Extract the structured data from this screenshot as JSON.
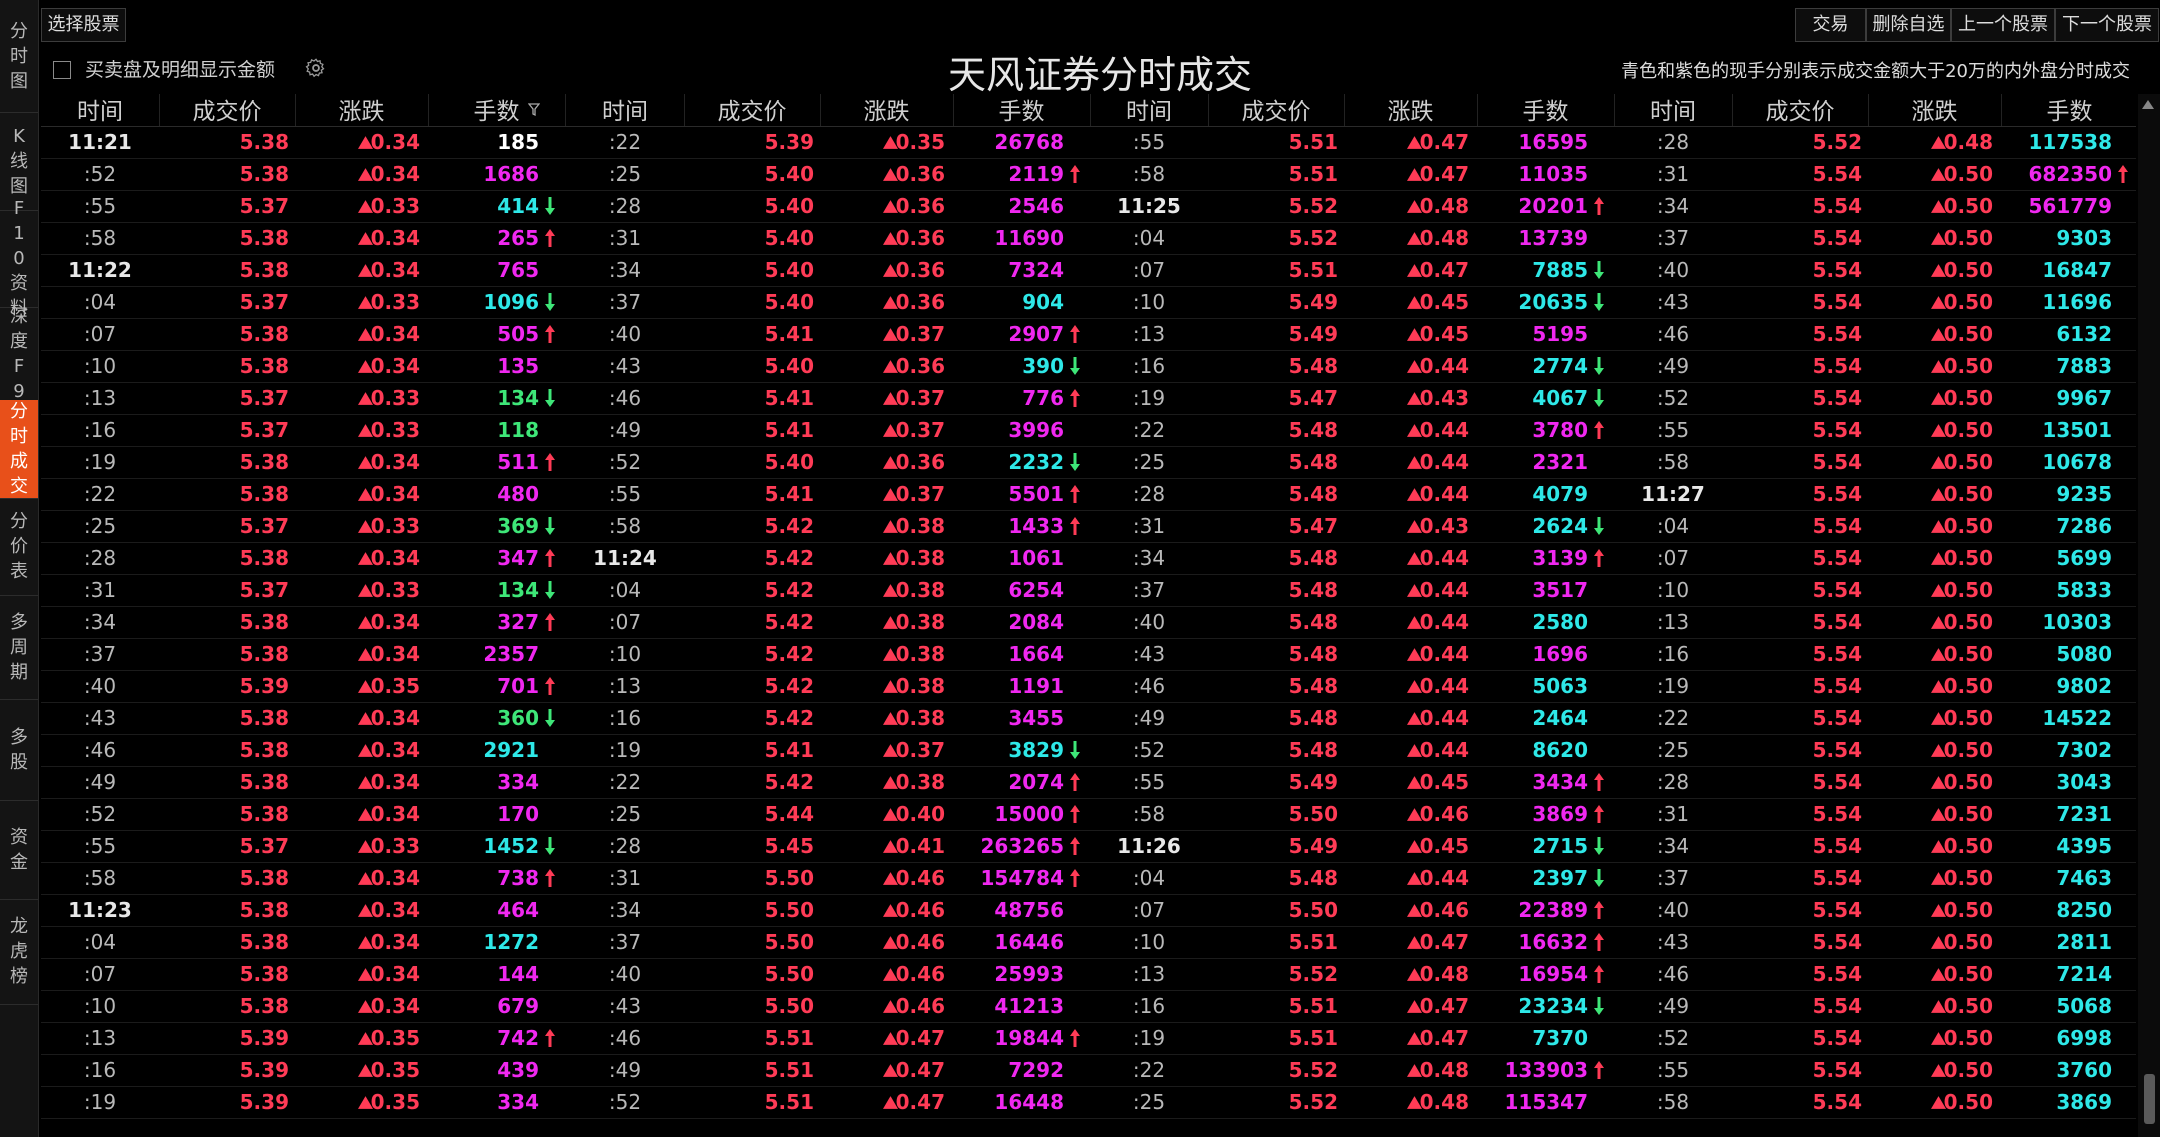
{
  "sidebar": {
    "items": [
      {
        "label": "分时图",
        "active": false
      },
      {
        "label": "K线图",
        "active": false
      },
      {
        "label": "F10资料",
        "active": false
      },
      {
        "label": "深度F9",
        "active": false
      },
      {
        "label": "分时成交",
        "active": true
      },
      {
        "label": "分价表",
        "active": false
      },
      {
        "label": "多周期",
        "active": false
      },
      {
        "label": "多股",
        "active": false
      },
      {
        "label": "资金",
        "active": false
      },
      {
        "label": "龙虎榜",
        "active": false
      }
    ]
  },
  "toolbar": {
    "select_stock": "选择股票",
    "trade": "交易",
    "delete_watch": "删除自选",
    "prev_stock": "上一个股票",
    "next_stock": "下一个股票",
    "show_amount_label": "买卖盘及明细显示金额",
    "show_amount_checked": false
  },
  "title": "天风证券分时成交",
  "note": "青色和紫色的现手分别表示成交金额大于20万的内外盘分时成交",
  "colors": {
    "up": "#ff3b56",
    "down": "#3ee678",
    "white": "#ffffff",
    "cyan": "#2ee8e8",
    "magenta": "#f028f0",
    "active_tab": "#e8501a"
  },
  "headers": [
    "时间",
    "成交价",
    "涨跌",
    "手数"
  ],
  "columns": [
    [
      [
        "11:21",
        "5.38",
        "0.34",
        "185",
        "w",
        ""
      ],
      [
        ":52",
        "5.38",
        "0.34",
        "1686",
        "m",
        ""
      ],
      [
        ":55",
        "5.37",
        "0.33",
        "414",
        "c",
        "d"
      ],
      [
        ":58",
        "5.38",
        "0.34",
        "265",
        "m",
        "u"
      ],
      [
        "11:22",
        "5.38",
        "0.34",
        "765",
        "m",
        ""
      ],
      [
        ":04",
        "5.37",
        "0.33",
        "1096",
        "c",
        "d"
      ],
      [
        ":07",
        "5.38",
        "0.34",
        "505",
        "m",
        "u"
      ],
      [
        ":10",
        "5.38",
        "0.34",
        "135",
        "m",
        ""
      ],
      [
        ":13",
        "5.37",
        "0.33",
        "134",
        "g",
        "d"
      ],
      [
        ":16",
        "5.37",
        "0.33",
        "118",
        "g",
        ""
      ],
      [
        ":19",
        "5.38",
        "0.34",
        "511",
        "m",
        "u"
      ],
      [
        ":22",
        "5.38",
        "0.34",
        "480",
        "m",
        ""
      ],
      [
        ":25",
        "5.37",
        "0.33",
        "369",
        "g",
        "d"
      ],
      [
        ":28",
        "5.38",
        "0.34",
        "347",
        "m",
        "u"
      ],
      [
        ":31",
        "5.37",
        "0.33",
        "134",
        "g",
        "d"
      ],
      [
        ":34",
        "5.38",
        "0.34",
        "327",
        "m",
        "u"
      ],
      [
        ":37",
        "5.38",
        "0.34",
        "2357",
        "m",
        ""
      ],
      [
        ":40",
        "5.39",
        "0.35",
        "701",
        "m",
        "u"
      ],
      [
        ":43",
        "5.38",
        "0.34",
        "360",
        "g",
        "d"
      ],
      [
        ":46",
        "5.38",
        "0.34",
        "2921",
        "c",
        ""
      ],
      [
        ":49",
        "5.38",
        "0.34",
        "334",
        "m",
        ""
      ],
      [
        ":52",
        "5.38",
        "0.34",
        "170",
        "m",
        ""
      ],
      [
        ":55",
        "5.37",
        "0.33",
        "1452",
        "c",
        "d"
      ],
      [
        ":58",
        "5.38",
        "0.34",
        "738",
        "m",
        "u"
      ],
      [
        "11:23",
        "5.38",
        "0.34",
        "464",
        "m",
        ""
      ],
      [
        ":04",
        "5.38",
        "0.34",
        "1272",
        "c",
        ""
      ],
      [
        ":07",
        "5.38",
        "0.34",
        "144",
        "m",
        ""
      ],
      [
        ":10",
        "5.38",
        "0.34",
        "679",
        "m",
        ""
      ],
      [
        ":13",
        "5.39",
        "0.35",
        "742",
        "m",
        "u"
      ],
      [
        ":16",
        "5.39",
        "0.35",
        "439",
        "m",
        ""
      ],
      [
        ":19",
        "5.39",
        "0.35",
        "334",
        "m",
        ""
      ]
    ],
    [
      [
        ":22",
        "5.39",
        "0.35",
        "26768",
        "m",
        ""
      ],
      [
        ":25",
        "5.40",
        "0.36",
        "2119",
        "m",
        "u"
      ],
      [
        ":28",
        "5.40",
        "0.36",
        "2546",
        "m",
        ""
      ],
      [
        ":31",
        "5.40",
        "0.36",
        "11690",
        "m",
        ""
      ],
      [
        ":34",
        "5.40",
        "0.36",
        "7324",
        "m",
        ""
      ],
      [
        ":37",
        "5.40",
        "0.36",
        "904",
        "c",
        ""
      ],
      [
        ":40",
        "5.41",
        "0.37",
        "2907",
        "m",
        "u"
      ],
      [
        ":43",
        "5.40",
        "0.36",
        "390",
        "c",
        "d"
      ],
      [
        ":46",
        "5.41",
        "0.37",
        "776",
        "m",
        "u"
      ],
      [
        ":49",
        "5.41",
        "0.37",
        "3996",
        "m",
        ""
      ],
      [
        ":52",
        "5.40",
        "0.36",
        "2232",
        "c",
        "d"
      ],
      [
        ":55",
        "5.41",
        "0.37",
        "5501",
        "m",
        "u"
      ],
      [
        ":58",
        "5.42",
        "0.38",
        "1433",
        "m",
        "u"
      ],
      [
        "11:24",
        "5.42",
        "0.38",
        "1061",
        "m",
        ""
      ],
      [
        ":04",
        "5.42",
        "0.38",
        "6254",
        "m",
        ""
      ],
      [
        ":07",
        "5.42",
        "0.38",
        "2084",
        "m",
        ""
      ],
      [
        ":10",
        "5.42",
        "0.38",
        "1664",
        "m",
        ""
      ],
      [
        ":13",
        "5.42",
        "0.38",
        "1191",
        "m",
        ""
      ],
      [
        ":16",
        "5.42",
        "0.38",
        "3455",
        "m",
        ""
      ],
      [
        ":19",
        "5.41",
        "0.37",
        "3829",
        "c",
        "d"
      ],
      [
        ":22",
        "5.42",
        "0.38",
        "2074",
        "m",
        "u"
      ],
      [
        ":25",
        "5.44",
        "0.40",
        "15000",
        "m",
        "u"
      ],
      [
        ":28",
        "5.45",
        "0.41",
        "263265",
        "m",
        "u"
      ],
      [
        ":31",
        "5.50",
        "0.46",
        "154784",
        "m",
        "u"
      ],
      [
        ":34",
        "5.50",
        "0.46",
        "48756",
        "m",
        ""
      ],
      [
        ":37",
        "5.50",
        "0.46",
        "16446",
        "m",
        ""
      ],
      [
        ":40",
        "5.50",
        "0.46",
        "25993",
        "m",
        ""
      ],
      [
        ":43",
        "5.50",
        "0.46",
        "41213",
        "m",
        ""
      ],
      [
        ":46",
        "5.51",
        "0.47",
        "19844",
        "m",
        "u"
      ],
      [
        ":49",
        "5.51",
        "0.47",
        "7292",
        "m",
        ""
      ],
      [
        ":52",
        "5.51",
        "0.47",
        "16448",
        "m",
        ""
      ]
    ],
    [
      [
        ":55",
        "5.51",
        "0.47",
        "16595",
        "m",
        ""
      ],
      [
        ":58",
        "5.51",
        "0.47",
        "11035",
        "m",
        ""
      ],
      [
        "11:25",
        "5.52",
        "0.48",
        "20201",
        "m",
        "u"
      ],
      [
        ":04",
        "5.52",
        "0.48",
        "13739",
        "m",
        ""
      ],
      [
        ":07",
        "5.51",
        "0.47",
        "7885",
        "c",
        "d"
      ],
      [
        ":10",
        "5.49",
        "0.45",
        "20635",
        "c",
        "d"
      ],
      [
        ":13",
        "5.49",
        "0.45",
        "5195",
        "m",
        ""
      ],
      [
        ":16",
        "5.48",
        "0.44",
        "2774",
        "c",
        "d"
      ],
      [
        ":19",
        "5.47",
        "0.43",
        "4067",
        "c",
        "d"
      ],
      [
        ":22",
        "5.48",
        "0.44",
        "3780",
        "m",
        "u"
      ],
      [
        ":25",
        "5.48",
        "0.44",
        "2321",
        "m",
        ""
      ],
      [
        ":28",
        "5.48",
        "0.44",
        "4079",
        "c",
        ""
      ],
      [
        ":31",
        "5.47",
        "0.43",
        "2624",
        "c",
        "d"
      ],
      [
        ":34",
        "5.48",
        "0.44",
        "3139",
        "m",
        "u"
      ],
      [
        ":37",
        "5.48",
        "0.44",
        "3517",
        "m",
        ""
      ],
      [
        ":40",
        "5.48",
        "0.44",
        "2580",
        "c",
        ""
      ],
      [
        ":43",
        "5.48",
        "0.44",
        "1696",
        "m",
        ""
      ],
      [
        ":46",
        "5.48",
        "0.44",
        "5063",
        "c",
        ""
      ],
      [
        ":49",
        "5.48",
        "0.44",
        "2464",
        "c",
        ""
      ],
      [
        ":52",
        "5.48",
        "0.44",
        "8620",
        "c",
        ""
      ],
      [
        ":55",
        "5.49",
        "0.45",
        "3434",
        "m",
        "u"
      ],
      [
        ":58",
        "5.50",
        "0.46",
        "3869",
        "m",
        "u"
      ],
      [
        "11:26",
        "5.49",
        "0.45",
        "2715",
        "c",
        "d"
      ],
      [
        ":04",
        "5.48",
        "0.44",
        "2397",
        "c",
        "d"
      ],
      [
        ":07",
        "5.50",
        "0.46",
        "22389",
        "m",
        "u"
      ],
      [
        ":10",
        "5.51",
        "0.47",
        "16632",
        "m",
        "u"
      ],
      [
        ":13",
        "5.52",
        "0.48",
        "16954",
        "m",
        "u"
      ],
      [
        ":16",
        "5.51",
        "0.47",
        "23234",
        "c",
        "d"
      ],
      [
        ":19",
        "5.51",
        "0.47",
        "7370",
        "c",
        ""
      ],
      [
        ":22",
        "5.52",
        "0.48",
        "133903",
        "m",
        "u"
      ],
      [
        ":25",
        "5.52",
        "0.48",
        "115347",
        "m",
        ""
      ]
    ],
    [
      [
        ":28",
        "5.52",
        "0.48",
        "117538",
        "c",
        ""
      ],
      [
        ":31",
        "5.54",
        "0.50",
        "682350",
        "m",
        "u"
      ],
      [
        ":34",
        "5.54",
        "0.50",
        "561779",
        "m",
        ""
      ],
      [
        ":37",
        "5.54",
        "0.50",
        "9303",
        "c",
        ""
      ],
      [
        ":40",
        "5.54",
        "0.50",
        "16847",
        "c",
        ""
      ],
      [
        ":43",
        "5.54",
        "0.50",
        "11696",
        "c",
        ""
      ],
      [
        ":46",
        "5.54",
        "0.50",
        "6132",
        "c",
        ""
      ],
      [
        ":49",
        "5.54",
        "0.50",
        "7883",
        "c",
        ""
      ],
      [
        ":52",
        "5.54",
        "0.50",
        "9967",
        "c",
        ""
      ],
      [
        ":55",
        "5.54",
        "0.50",
        "13501",
        "c",
        ""
      ],
      [
        ":58",
        "5.54",
        "0.50",
        "10678",
        "c",
        ""
      ],
      [
        "11:27",
        "5.54",
        "0.50",
        "9235",
        "c",
        ""
      ],
      [
        ":04",
        "5.54",
        "0.50",
        "7286",
        "c",
        ""
      ],
      [
        ":07",
        "5.54",
        "0.50",
        "5699",
        "c",
        ""
      ],
      [
        ":10",
        "5.54",
        "0.50",
        "5833",
        "c",
        ""
      ],
      [
        ":13",
        "5.54",
        "0.50",
        "10303",
        "c",
        ""
      ],
      [
        ":16",
        "5.54",
        "0.50",
        "5080",
        "c",
        ""
      ],
      [
        ":19",
        "5.54",
        "0.50",
        "9802",
        "c",
        ""
      ],
      [
        ":22",
        "5.54",
        "0.50",
        "14522",
        "c",
        ""
      ],
      [
        ":25",
        "5.54",
        "0.50",
        "7302",
        "c",
        ""
      ],
      [
        ":28",
        "5.54",
        "0.50",
        "3043",
        "c",
        ""
      ],
      [
        ":31",
        "5.54",
        "0.50",
        "7231",
        "c",
        ""
      ],
      [
        ":34",
        "5.54",
        "0.50",
        "4395",
        "c",
        ""
      ],
      [
        ":37",
        "5.54",
        "0.50",
        "7463",
        "c",
        ""
      ],
      [
        ":40",
        "5.54",
        "0.50",
        "8250",
        "c",
        ""
      ],
      [
        ":43",
        "5.54",
        "0.50",
        "2811",
        "c",
        ""
      ],
      [
        ":46",
        "5.54",
        "0.50",
        "7214",
        "c",
        ""
      ],
      [
        ":49",
        "5.54",
        "0.50",
        "5068",
        "c",
        ""
      ],
      [
        ":52",
        "5.54",
        "0.50",
        "6998",
        "c",
        ""
      ],
      [
        ":55",
        "5.54",
        "0.50",
        "3760",
        "c",
        ""
      ],
      [
        ":58",
        "5.54",
        "0.50",
        "3869",
        "c",
        ""
      ]
    ]
  ]
}
